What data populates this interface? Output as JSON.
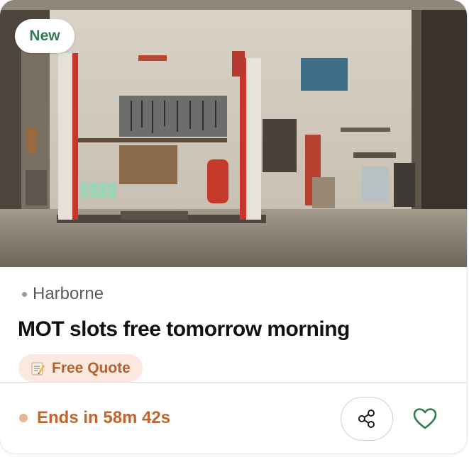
{
  "listing": {
    "badge": "New",
    "location": "Harborne",
    "title": "MOT slots free tomorrow morning",
    "tag": {
      "icon": "memo-icon",
      "label": "Free Quote"
    },
    "countdown": "Ends in 58m 42s",
    "image": "garage-workshop-photo"
  },
  "actions": {
    "share_icon": "share-icon",
    "favorite_icon": "heart-icon"
  },
  "colors": {
    "badge_text": "#2f7d4e",
    "tag_bg": "#fbe9e0",
    "accent": "#c0652f",
    "favorite": "#2f7d4e"
  }
}
